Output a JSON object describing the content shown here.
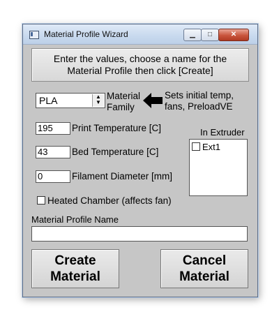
{
  "window": {
    "title": "Material Profile Wizard"
  },
  "titlebar": {
    "min": "▁",
    "max": "□",
    "close": "✕"
  },
  "instructions": {
    "line1": "Enter the values, choose a name for the",
    "line2": "Material Profile then click [Create]"
  },
  "family": {
    "selected": "PLA",
    "label1": "Material",
    "label2": "Family",
    "hint1": "Sets initial temp,",
    "hint2": "fans, PreloadVE"
  },
  "print_temp": {
    "value": "195",
    "label": "Print Temperature [C]"
  },
  "bed_temp": {
    "value": "43",
    "label": "Bed Temperature [C]"
  },
  "filament": {
    "value": "0",
    "label": "Filament Diameter [mm]"
  },
  "extruder": {
    "heading": "In Extruder",
    "items": [
      "Ext1"
    ]
  },
  "heated_chamber": {
    "label": "Heated Chamber (affects fan)",
    "checked": false
  },
  "profile_name": {
    "label": "Material Profile Name",
    "value": ""
  },
  "buttons": {
    "create_line1": "Create",
    "create_line2": "Material",
    "cancel_line1": "Cancel",
    "cancel_line2": "Material"
  }
}
